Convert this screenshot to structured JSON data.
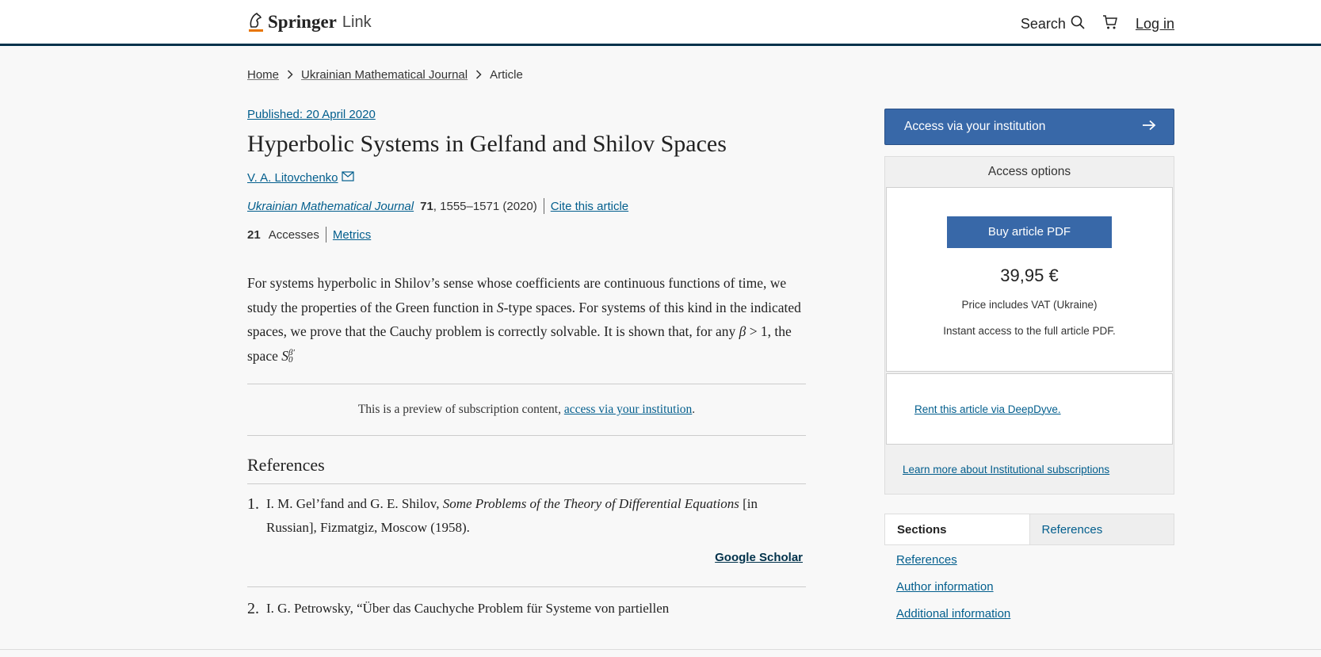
{
  "header": {
    "brand": "Springer",
    "brand_sub": "Link",
    "search_label": "Search",
    "login_label": "Log in"
  },
  "breadcrumb": {
    "home": "Home",
    "journal": "Ukrainian Mathematical Journal",
    "current": "Article"
  },
  "article": {
    "published": "Published: 20 April 2020",
    "title": "Hyperbolic Systems in Gelfand and Shilov Spaces",
    "author": "V. A. Litovchenko",
    "journal": "Ukrainian Mathematical Journal",
    "volume": "71",
    "pages_year": ", 1555–1571 (2020)",
    "cite_label": "Cite this article",
    "accesses_count": "21",
    "accesses_label": "Accesses",
    "metrics_label": "Metrics",
    "abstract_part1": "For systems hyperbolic in Shilov’s sense whose coefficients are continuous functions of time, we study the properties of the Green function in ",
    "abstract_italic_s": "S",
    "abstract_part2": "-type spaces. For systems of this kind in the indicated spaces, we prove that the Cauchy problem is correctly solvable. It is shown that, for any ",
    "abstract_beta": "β",
    "abstract_part3": " > 1, the space ",
    "abstract_space": "S",
    "abstract_sub": "0",
    "abstract_sup": "β′",
    "preview_text": "This is a preview of subscription content, ",
    "preview_link": "access via your institution",
    "preview_end": "."
  },
  "references": {
    "title": "References",
    "items": [
      {
        "num": "1.",
        "pre": "I. M. Gel’fand and G. E. Shilov, ",
        "italic": "Some Problems of the Theory of Differential Equations",
        "post": " [in Russian], Fizmatgiz, Moscow (1958).",
        "scholar": "Google Scholar"
      },
      {
        "num": "2.",
        "text": "I. G. Petrowsky, “Über das Cauchyche Problem für Systeme von partiellen"
      }
    ]
  },
  "sidebar": {
    "institution_button": "Access via your institution",
    "access_options": "Access options",
    "buy_button": "Buy article PDF",
    "price": "39,95 €",
    "vat": "Price includes VAT (Ukraine)",
    "instant": "Instant access to the full article PDF.",
    "rent": "Rent this article via DeepDyve.",
    "learn_more": "Learn more about Institutional subscriptions",
    "tabs": [
      "Sections",
      "References"
    ],
    "section_links": [
      "References",
      "Author information",
      "Additional information"
    ]
  },
  "colors": {
    "link": "#025e8d",
    "primary_button": "#3868a8",
    "header_rule": "#01324b"
  }
}
